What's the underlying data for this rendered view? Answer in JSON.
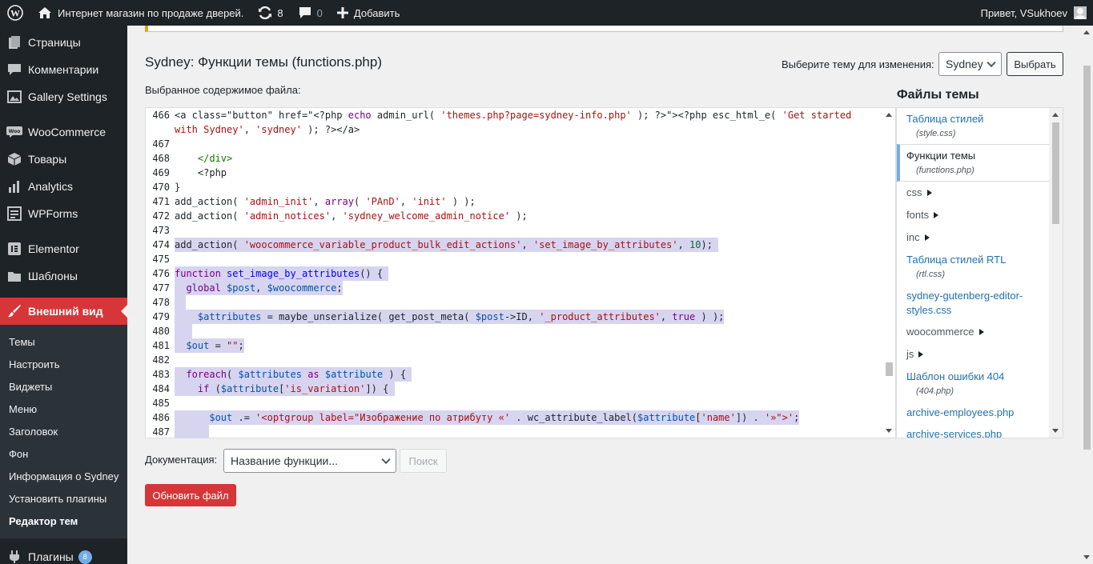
{
  "adminbar": {
    "site_name": "Интернет магазин по продаже дверей.",
    "updates_count": "8",
    "comments_count": "0",
    "add_label": "Добавить",
    "greeting": "Привет, VSukhoev"
  },
  "menu": {
    "pages": "Страницы",
    "comments": "Комментарии",
    "gallery": "Gallery Settings",
    "woocommerce": "WooCommerce",
    "products": "Товары",
    "analytics": "Analytics",
    "wpforms": "WPForms",
    "elementor": "Elementor",
    "templates": "Шаблоны",
    "appearance": "Внешний вид",
    "plugins": "Плагины",
    "plugins_badge": "8",
    "submenu": [
      "Темы",
      "Настроить",
      "Виджеты",
      "Меню",
      "Заголовок",
      "Фон",
      "Информация о Sydney",
      "Установить плагины",
      "Редактор тем"
    ]
  },
  "page": {
    "title": "Sydney: Функции темы (functions.php)",
    "select_theme_label": "Выберите тему для изменения:",
    "theme_value": "Sydney",
    "select_button": "Выбрать",
    "selected_content_label": "Выбранное содержимое файла:",
    "doc_label": "Документация:",
    "doc_placeholder": "Название функции...",
    "lookup_button": "Поиск",
    "update_button": "Обновить файл"
  },
  "files": {
    "title": "Файлы темы",
    "items": [
      {
        "name": "Таблица стилей",
        "file": "(style.css)"
      },
      {
        "name": "Функции темы",
        "file": "(functions.php)"
      },
      {
        "name": "css"
      },
      {
        "name": "fonts"
      },
      {
        "name": "inc"
      },
      {
        "name": "Таблица стилей RTL",
        "file": "(rtl.css)"
      },
      {
        "name": "sydney-gutenberg-editor-styles.css"
      },
      {
        "name": "woocommerce"
      },
      {
        "name": "js"
      },
      {
        "name": "Шаблон ошибки 404",
        "file": "(404.php)"
      },
      {
        "name": "archive-employees.php"
      },
      {
        "name": "archive-services.php"
      }
    ]
  },
  "code": {
    "line_numbers": [
      "466",
      "467",
      "468",
      "469",
      "470",
      "471",
      "472",
      "473",
      "474",
      "475",
      "476",
      "477",
      "478",
      "479",
      "480",
      "481",
      "482",
      "483",
      "484",
      "485",
      "486",
      "487"
    ]
  }
}
